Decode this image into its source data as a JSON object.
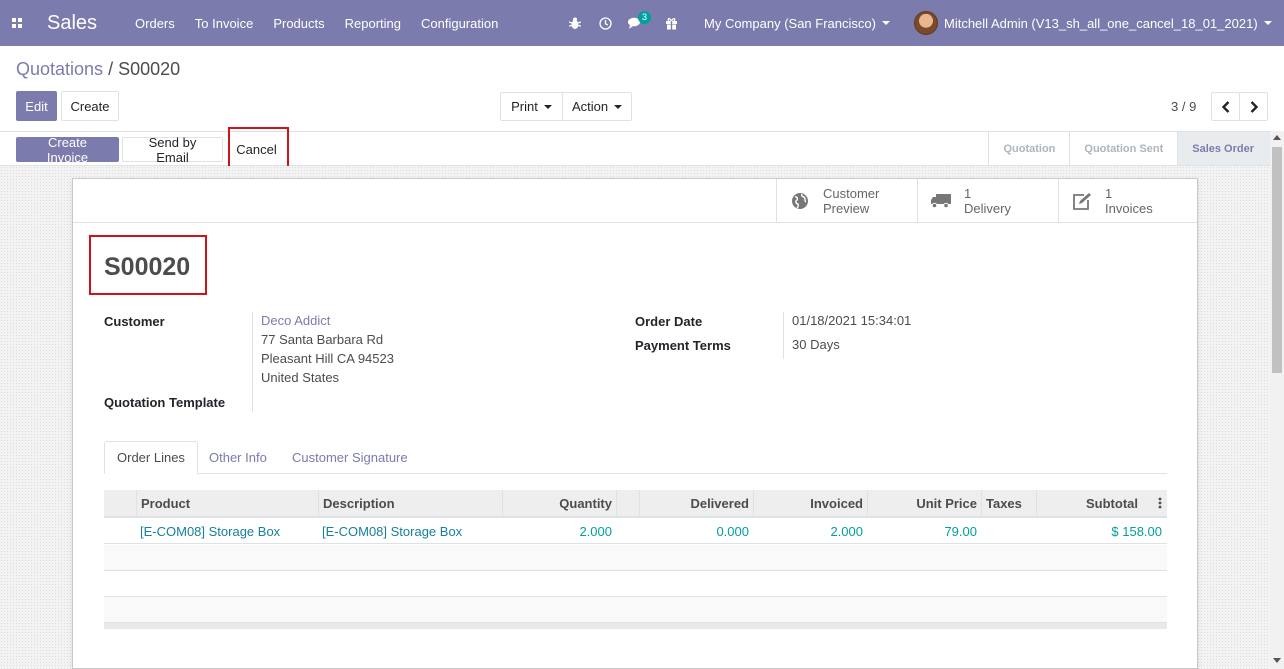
{
  "navbar": {
    "app_name": "Sales",
    "menu": [
      "Orders",
      "To Invoice",
      "Products",
      "Reporting",
      "Configuration"
    ],
    "messages_count": "3",
    "company": "My Company (San Francisco)",
    "user": "Mitchell Admin (V13_sh_all_one_cancel_18_01_2021)",
    "color": "#7c7bad"
  },
  "breadcrumb": {
    "parent": "Quotations",
    "separator": "/",
    "current": "S00020"
  },
  "control": {
    "edit": "Edit",
    "create": "Create",
    "print": "Print",
    "action": "Action",
    "pager": "3 / 9"
  },
  "statusbar": {
    "create_invoice": "Create Invoice",
    "send_email": "Send by Email",
    "cancel": "Cancel",
    "stages": [
      "Quotation",
      "Quotation Sent",
      "Sales Order"
    ],
    "active_stage": "Sales Order"
  },
  "smart_buttons": {
    "preview": [
      "Customer",
      "Preview"
    ],
    "delivery": [
      "1",
      "Delivery"
    ],
    "invoices": [
      "1",
      "Invoices"
    ]
  },
  "order": {
    "name": "S00020",
    "customer_label": "Customer",
    "customer_name": "Deco Addict",
    "address_lines": [
      "77 Santa Barbara Rd",
      "Pleasant Hill CA 94523",
      "United States"
    ],
    "template_label": "Quotation Template",
    "order_date_label": "Order Date",
    "order_date": "01/18/2021 15:34:01",
    "payment_terms_label": "Payment Terms",
    "payment_terms": "30 Days"
  },
  "tabs": [
    "Order Lines",
    "Other Info",
    "Customer Signature"
  ],
  "lines": {
    "headers": [
      "Product",
      "Description",
      "Quantity",
      "Delivered",
      "Invoiced",
      "Unit Price",
      "Taxes",
      "Subtotal"
    ],
    "rows": [
      {
        "product": "[E-COM08] Storage Box",
        "description": "[E-COM08] Storage Box",
        "quantity": "2.000",
        "delivered": "0.000",
        "invoiced": "2.000",
        "unit_price": "79.00",
        "taxes": "",
        "subtotal": "$ 158.00"
      }
    ]
  }
}
